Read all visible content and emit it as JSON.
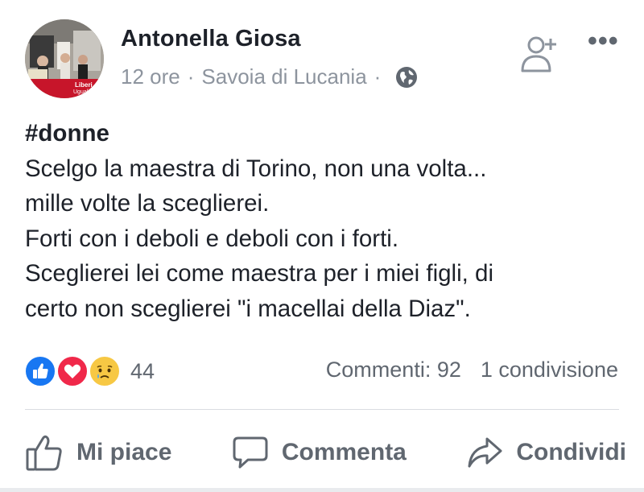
{
  "post": {
    "author": "Antonella Giosa",
    "time": "12 ore",
    "separator": "·",
    "location": "Savoia di Lucania",
    "privacy_icon": "globe-icon",
    "hashtag": "#donne",
    "lines": [
      "Scelgo la maestra di Torino, non una volta...",
      "mille volte la sceglierei.",
      "Forti con i deboli e deboli con i forti.",
      "Sceglierei lei come maestra per i miei figli, di",
      "certo non sceglierei \"i macellai della Diaz\"."
    ]
  },
  "header_actions": {
    "add_friend_icon": "add-friend-icon",
    "more_label": "•••"
  },
  "avatar": {
    "banner_text_1": "Liberi",
    "banner_text_2": "Uguali"
  },
  "reactions": {
    "types": [
      "like",
      "love",
      "sad"
    ],
    "count": "44"
  },
  "stats": {
    "comments": "Commenti: 92",
    "shares": "1 condivisione"
  },
  "actions": {
    "like": "Mi piace",
    "comment": "Commenta",
    "share": "Condividi"
  },
  "colors": {
    "like_blue": "#1877f2",
    "love_red": "#f0284a",
    "sad_yellow": "#f7c844",
    "secondary_text": "#8d949e",
    "action_gray": "#606770"
  }
}
